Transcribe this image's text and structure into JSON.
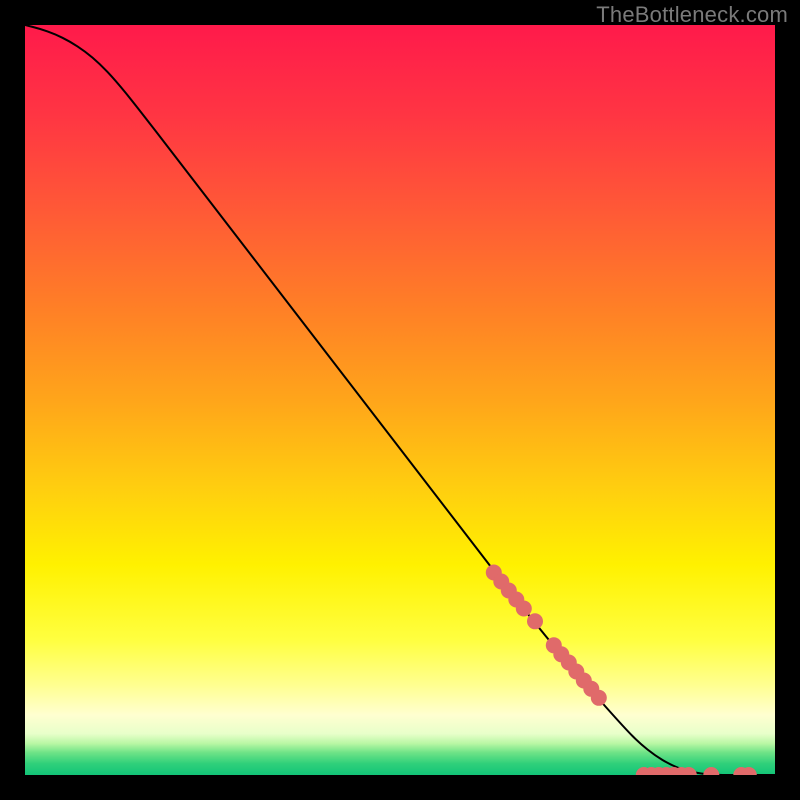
{
  "watermark": "TheBottleneck.com",
  "chart_data": {
    "type": "line",
    "title": "",
    "xlabel": "",
    "ylabel": "",
    "xlim": [
      0,
      100
    ],
    "ylim": [
      0,
      100
    ],
    "background_gradient_stops": [
      {
        "offset": 0.0,
        "color": "#ff1a4b"
      },
      {
        "offset": 0.12,
        "color": "#ff3543"
      },
      {
        "offset": 0.25,
        "color": "#ff5a36"
      },
      {
        "offset": 0.38,
        "color": "#ff8026"
      },
      {
        "offset": 0.5,
        "color": "#ffa51a"
      },
      {
        "offset": 0.62,
        "color": "#ffcf0f"
      },
      {
        "offset": 0.72,
        "color": "#fff100"
      },
      {
        "offset": 0.82,
        "color": "#ffff40"
      },
      {
        "offset": 0.88,
        "color": "#ffff90"
      },
      {
        "offset": 0.92,
        "color": "#ffffd0"
      },
      {
        "offset": 0.945,
        "color": "#e8ffca"
      },
      {
        "offset": 0.958,
        "color": "#b9f7a4"
      },
      {
        "offset": 0.97,
        "color": "#6fe387"
      },
      {
        "offset": 0.985,
        "color": "#2fd07a"
      },
      {
        "offset": 1.0,
        "color": "#12c478"
      }
    ],
    "series": [
      {
        "name": "bottleneck-curve",
        "type": "line",
        "color": "#000000",
        "width": 2,
        "x": [
          0,
          2,
          4,
          6,
          8,
          10,
          12,
          15,
          20,
          25,
          30,
          35,
          40,
          45,
          50,
          55,
          60,
          65,
          70,
          75,
          80,
          82,
          84,
          86,
          88,
          90,
          92,
          94,
          96,
          98,
          100
        ],
        "y": [
          100,
          99.5,
          98.8,
          97.8,
          96.5,
          94.8,
          92.7,
          89.0,
          82.5,
          76.0,
          69.5,
          63.0,
          56.5,
          50.0,
          43.5,
          37.0,
          30.5,
          24.0,
          17.8,
          11.8,
          6.2,
          4.2,
          2.6,
          1.4,
          0.6,
          0.2,
          0.0,
          0.0,
          0.0,
          0.0,
          0.0
        ]
      },
      {
        "name": "marker-cluster",
        "type": "scatter",
        "color": "#e06a6a",
        "radius": 8,
        "x": [
          62.5,
          63.5,
          64.5,
          65.5,
          66.5,
          68.0,
          70.5,
          71.5,
          72.5,
          73.5,
          74.5,
          75.5,
          76.5,
          82.5,
          83.5,
          84.5,
          85.5,
          86.5,
          87.5,
          88.5,
          91.5,
          95.5,
          96.5
        ],
        "y": [
          27.0,
          25.8,
          24.6,
          23.4,
          22.2,
          20.5,
          17.3,
          16.1,
          15.0,
          13.8,
          12.6,
          11.5,
          10.3,
          0.0,
          0.0,
          0.0,
          0.0,
          0.0,
          0.0,
          0.0,
          0.0,
          0.0,
          0.0
        ]
      }
    ]
  }
}
